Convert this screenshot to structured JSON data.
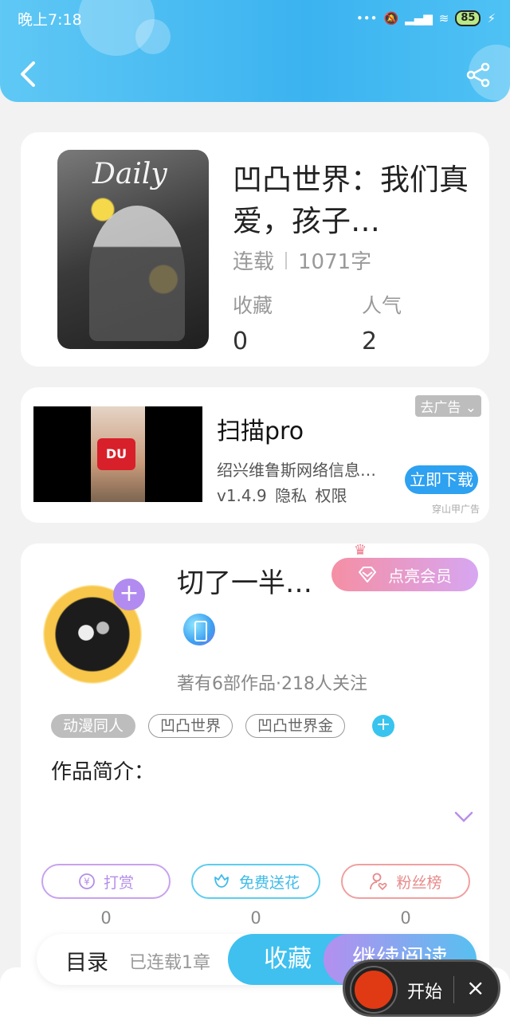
{
  "status": {
    "time": "晚上7:18",
    "battery": "85"
  },
  "book": {
    "cover_text": "Daily",
    "title": "凹凸世界：我们真爱，孩子…",
    "status": "连载",
    "word_count": "1071字",
    "favorites_label": "收藏",
    "favorites_value": "0",
    "popularity_label": "人气",
    "popularity_value": "2"
  },
  "ad": {
    "close_label": "去广告",
    "image_sign": "DU",
    "title": "扫描pro",
    "company": "绍兴维鲁斯网络信息…",
    "version_info": "v1.4.9  隐私  权限",
    "download_label": "立即下载",
    "source": "穿山甲广告"
  },
  "author": {
    "name": "切了一半…",
    "vip_label": "点亮会员",
    "stats": "著有6部作品·218人关注",
    "tags": [
      "动漫同人",
      "凹凸世界",
      "凹凸世界金"
    ],
    "intro_title": "作品简介：",
    "actions": [
      {
        "label": "打赏",
        "count": "0",
        "color": "#c9a2ee"
      },
      {
        "label": "免费送花",
        "count": "0",
        "color": "#5dcdf0"
      },
      {
        "label": "粉丝榜",
        "count": "0",
        "color": "#f0a0a0"
      }
    ]
  },
  "bottom": {
    "catalog": "目录",
    "chapters": "已连载1章",
    "collect": "收藏",
    "continue": "继续阅读"
  },
  "recorder": {
    "start": "开始",
    "close": "×"
  }
}
